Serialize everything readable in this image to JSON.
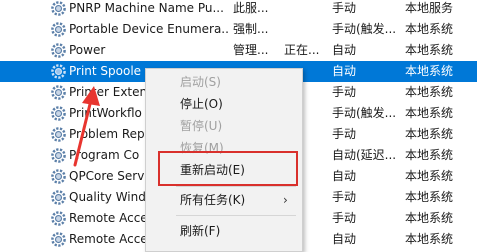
{
  "services": [
    {
      "name": "PNRP Machine Name Pu...",
      "description": "此服...",
      "status": "",
      "startup": "手动",
      "logon": "本地服务"
    },
    {
      "name": "Portable Device Enumera...",
      "description": "强制...",
      "status": "",
      "startup": "手动(触发...",
      "logon": "本地系统"
    },
    {
      "name": "Power",
      "description": "管理...",
      "status": "正在...",
      "startup": "自动",
      "logon": "本地系统"
    },
    {
      "name": "Print Spoole",
      "description": "",
      "status": "",
      "startup": "自动",
      "logon": "本地系统",
      "selected": true
    },
    {
      "name": "Printer Exten",
      "description": "",
      "status": "",
      "startup": "手动",
      "logon": "本地系统"
    },
    {
      "name": "PrintWorkflo",
      "description": "",
      "status": "",
      "startup": "手动(触发...",
      "logon": "本地系统"
    },
    {
      "name": "Problem Rep",
      "description": "",
      "status": "",
      "startup": "手动",
      "logon": "本地系统"
    },
    {
      "name": "Program Co",
      "description": "",
      "status": "",
      "startup": "自动(延迟...",
      "logon": "本地系统"
    },
    {
      "name": "QPCore Serv",
      "description": "",
      "status": "",
      "startup": "自动",
      "logon": "本地系统"
    },
    {
      "name": "Quality Wind",
      "description": "",
      "status": "",
      "startup": "手动",
      "logon": "本地系统"
    },
    {
      "name": "Remote Acce",
      "description": "",
      "status": "",
      "startup": "手动",
      "logon": "本地系统"
    },
    {
      "name": "Remote Acce",
      "description": "",
      "status": "",
      "startup": "自动",
      "logon": "本地系统"
    }
  ],
  "context_menu": {
    "start": "启动(S)",
    "stop": "停止(O)",
    "pause": "暂停(U)",
    "resume": "恢复(M)",
    "restart": "重新启动(E)",
    "all_tasks": "所有任务(K)",
    "refresh": "刷新(F)"
  },
  "colors": {
    "selection": "#0078d7",
    "highlight_box": "#d9302c",
    "arrow": "#e8352f"
  },
  "icons": {
    "service": "gear-icon",
    "submenu": "chevron-right-icon",
    "annotation": "red-arrow-icon"
  }
}
